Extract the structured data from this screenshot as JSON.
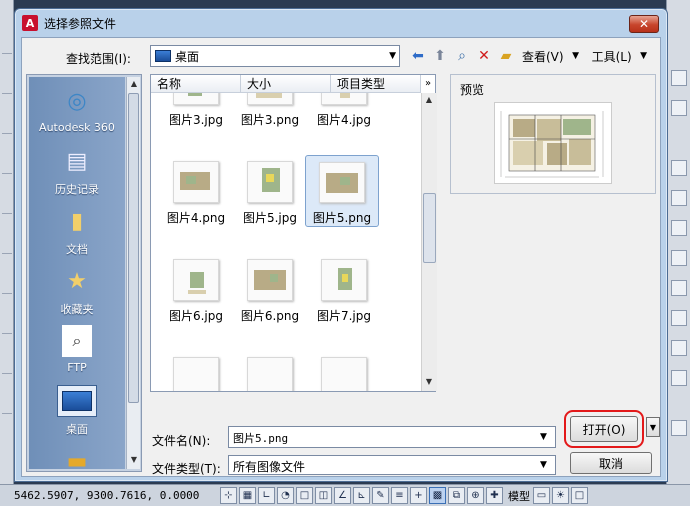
{
  "dialog": {
    "title": "选择参照文件",
    "close_label": "✕",
    "app_icon": "A"
  },
  "lookin": {
    "label": "查找范围(I):",
    "value": "桌面",
    "icons": [
      "back-arrow-icon",
      "up-folder-icon",
      "search-web-icon",
      "delete-icon",
      "new-folder-icon"
    ],
    "view_menu": "查看(V)",
    "tools_menu": "工具(L)"
  },
  "places": [
    {
      "label": "Autodesk 360",
      "icon": "autodesk-360-icon"
    },
    {
      "label": "历史记录",
      "icon": "history-icon"
    },
    {
      "label": "文档",
      "icon": "documents-folder-icon"
    },
    {
      "label": "收藏夹",
      "icon": "favorites-folder-icon"
    },
    {
      "label": "FTP",
      "icon": "ftp-icon"
    },
    {
      "label": "桌面",
      "icon": "desktop-icon",
      "selected": true
    },
    {
      "label": "",
      "icon": "buzzsaw-folder-icon"
    }
  ],
  "file_list": {
    "columns": [
      "名称",
      "大小",
      "项目类型"
    ],
    "more": "»",
    "files": [
      "图片3.jpg",
      "图片3.png",
      "图片4.jpg",
      "图片4.png",
      "图片5.jpg",
      "图片5.png",
      "图片6.jpg",
      "图片6.png",
      "图片7.jpg"
    ],
    "selected_file": "图片5.png"
  },
  "preview": {
    "label": "预览"
  },
  "file_name": {
    "label": "文件名(N):",
    "value": "图片5.png"
  },
  "file_type": {
    "label": "文件类型(T):",
    "value": "所有图像文件"
  },
  "buttons": {
    "open": "打开(O)",
    "open_dropdown": "▼",
    "cancel": "取消"
  },
  "statusbar": {
    "coords": "5462.5907,  9300.7616, 0.0000",
    "model_label": "模型"
  },
  "colors": {
    "highlight_red": "#e3191a",
    "titlebar_blue": "#b9d1ea",
    "close_red": "#c7452c"
  }
}
